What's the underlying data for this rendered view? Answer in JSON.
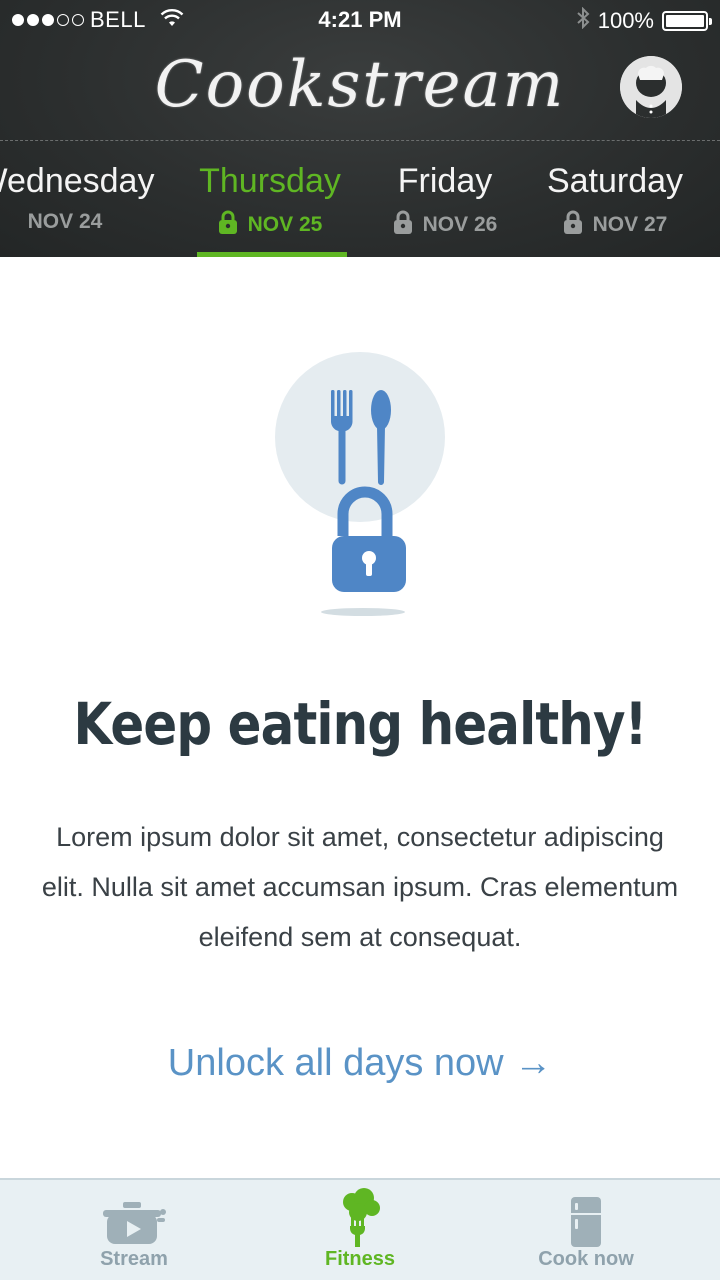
{
  "status_bar": {
    "carrier": "BELL",
    "time": "4:21 PM",
    "battery": "100%"
  },
  "app": {
    "title": "Cookstream"
  },
  "days": [
    {
      "name": "Wednesday",
      "date": "NOV 24",
      "locked": false
    },
    {
      "name": "Thursday",
      "date": "NOV 25",
      "locked": true
    },
    {
      "name": "Friday",
      "date": "NOV 26",
      "locked": true
    },
    {
      "name": "Saturday",
      "date": "NOV 27",
      "locked": true
    }
  ],
  "main": {
    "headline": "Keep eating healthy!",
    "body": "Lorem ipsum dolor sit amet, consectetur adipiscing elit. Nulla sit amet accumsan ipsum. Cras elementum eleifend sem at consequat.",
    "cta": "Unlock all days now →"
  },
  "tabbar": {
    "tabs": [
      {
        "label": "Stream",
        "icon": "pot-play-icon"
      },
      {
        "label": "Fitness",
        "icon": "broccoli-fork-icon"
      },
      {
        "label": "Cook now",
        "icon": "fridge-icon"
      }
    ]
  },
  "colors": {
    "accent_green": "#5fb623",
    "link_blue": "#5a93c6",
    "header_bg": "#2b2e2e",
    "tabbar_bg": "#e8f0f3"
  }
}
